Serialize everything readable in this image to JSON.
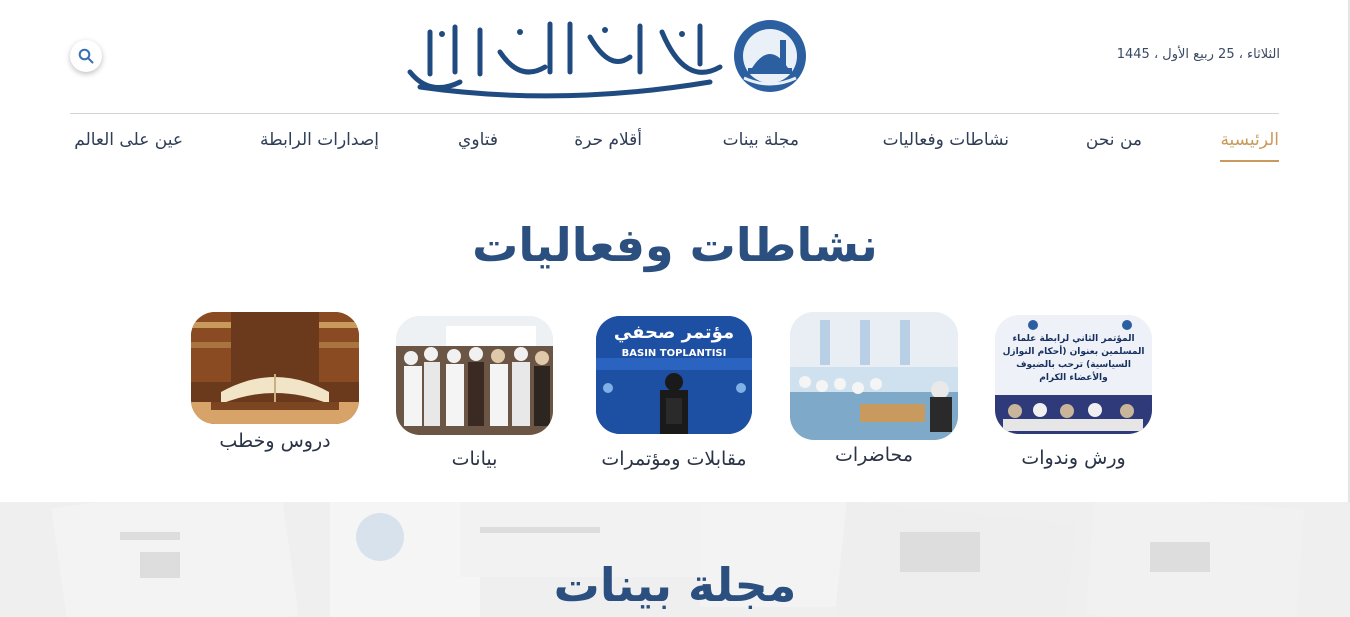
{
  "header": {
    "date": "الثلاثاء ، 25 ربيع الأول ، 1445",
    "logo_text": "رابطة علماء المسلمين",
    "search_icon": "search-icon"
  },
  "nav": {
    "items": [
      {
        "label": "الرئيسية",
        "active": true
      },
      {
        "label": "من نحن"
      },
      {
        "label": "نشاطات وفعاليات"
      },
      {
        "label": "مجلة بينات"
      },
      {
        "label": "أقلام حرة"
      },
      {
        "label": "فتاوي"
      },
      {
        "label": "إصدارات الرابطة"
      },
      {
        "label": "عين على العالم"
      }
    ]
  },
  "activities": {
    "title": "نشاطات وفعاليات",
    "cards": [
      {
        "label": "ورش وندوات",
        "image_text": "المؤتمر الثاني لرابطة علماء المسلمين بعنوان (أحكام النوازل السياسية) ترحب بالضيوف والأعضاء الكرام"
      },
      {
        "label": "محاضرات"
      },
      {
        "label": "مقابلات ومؤتمرات",
        "image_text": "مؤتمر صحفي",
        "image_subtext": "BASIN TOPLANTISI"
      },
      {
        "label": "بيانات"
      },
      {
        "label": "دروس وخطب"
      }
    ]
  },
  "magazine": {
    "title": "مجلة بينات"
  },
  "colors": {
    "accent": "#c99a5c",
    "brand": "#2b4f7e"
  }
}
